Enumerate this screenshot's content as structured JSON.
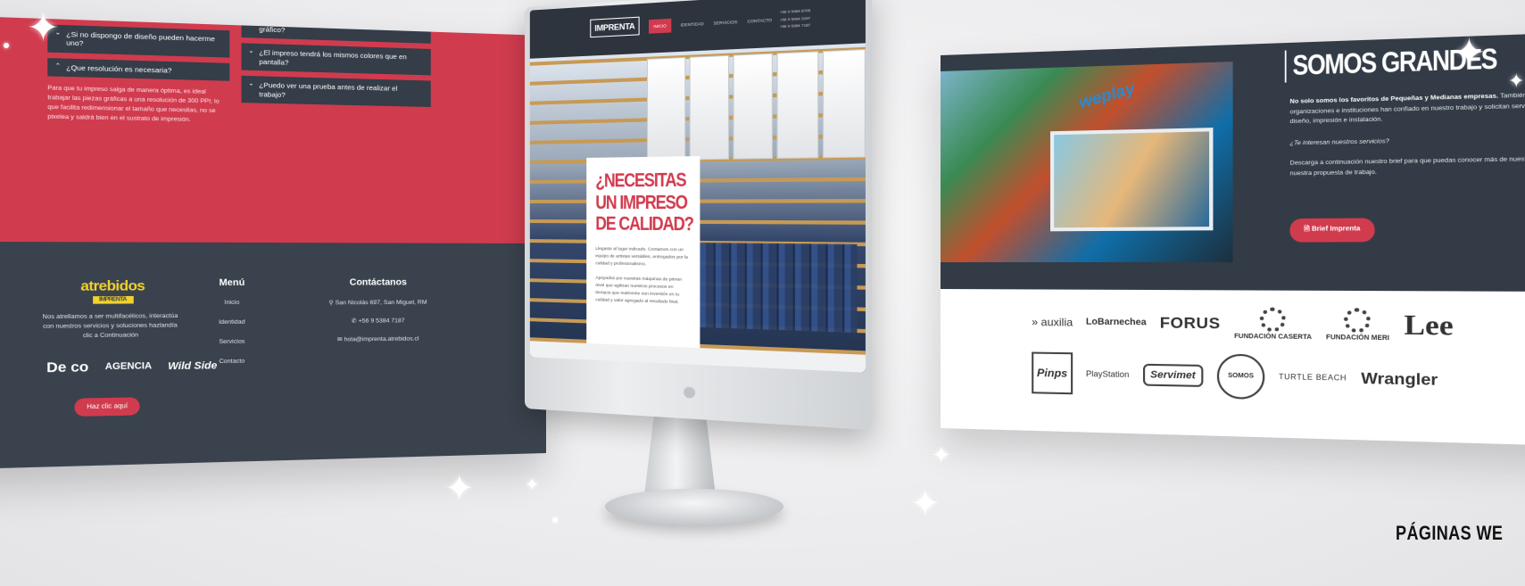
{
  "left_panel": {
    "faq_left": [
      {
        "q": "¿Si no dispongo de diseño pueden hacerme uno?",
        "open": false
      },
      {
        "q": "¿Que resolución es necesaria?",
        "open": true
      }
    ],
    "faq_answer": "Para que tu impreso salga de manera óptima, es ideal trabajar las piezas gráficas a una resolución de 300 PPI; lo que facilita redimensionar el tamaño que necesitas, no se pixelea y saldrá bien en el sustrato de impresión.",
    "faq_right": [
      {
        "q": "gráfico?"
      },
      {
        "q": "¿El impreso tendrá los mismos colores que en pantalla?"
      },
      {
        "q": "¿Puedo ver una prueba antes de realizar el trabajo?"
      }
    ],
    "brand": {
      "name": "atrebidos",
      "tag": "IMPRENTA"
    },
    "description": "Nos atrellamos a ser multifacéticos, interactúa con nuestros servicios y soluciones hazlandía clic a Continuación",
    "partners": [
      "De co",
      "AGENCIA",
      "Wild Side"
    ],
    "cta": "Haz clic aquí",
    "menu": {
      "title": "Menú",
      "items": [
        "Inicio",
        "Identidad",
        "Servicios",
        "Contacto"
      ]
    },
    "contact": {
      "title": "Contáctanos",
      "address": "San Nicolás 697, San Miguel, RM",
      "phone": "+56 9 5384 7187",
      "email": "hola@imprenta.atrebidos.cl"
    }
  },
  "monitor": {
    "logo": "IMPRENTA",
    "nav": [
      {
        "label": "INICIO",
        "active": true
      },
      {
        "label": "IDENTIDAD",
        "active": false
      },
      {
        "label": "SERVICIOS",
        "active": false
      },
      {
        "label": "CONTACTO",
        "active": false
      }
    ],
    "phones": [
      "+56 9 5464 8705",
      "+56 9 5994 2097",
      "+56 9 5384 7187"
    ],
    "hero_title": "¿NECESITAS UN IMPRESO DE CALIDAD?",
    "hero_p1": "Llegaste al lugar indicado. Contamos con un equipo de artistas versátiles, entregados por la calidad y profesionalismo.",
    "hero_p2": "Apoyados por nuestras máquinas de primer nivel que agilizan nuestros procesos en tiempos que realmente son inversión en tu calidad y valor agregado al resultado final."
  },
  "right_panel": {
    "title": "SOMOS GRANDES",
    "text_lead": "No solo somos los favoritos de Pequeñas y Medianas empresas.",
    "text_rest": "También empresas de retail, organizaciones e instituciones han confiado en nuestro trabajo y solicitan servicios de asesoría y diseño, impresión e instalación.",
    "question": "¿Te interesan nuestros servicios?",
    "download": "Descarga a continuación nuestro brief para que puedas conocer más de nuestros servicios y de nuestra propuesta de trabajo.",
    "button": "Brief Imprenta",
    "photo_text": "weplay",
    "logos_row1": [
      "auxilia",
      "LoBarnechea",
      "FORUS",
      "FUNDACIÓN CASERTA",
      "FUNDACIÓN MERI",
      "Lee"
    ],
    "logos_row2": [
      "Pinps",
      "PlayStation",
      "Servimet",
      "SOMOS",
      "TURTLE BEACH",
      "Wrangler"
    ]
  },
  "caption": "PÁGINAS WE"
}
